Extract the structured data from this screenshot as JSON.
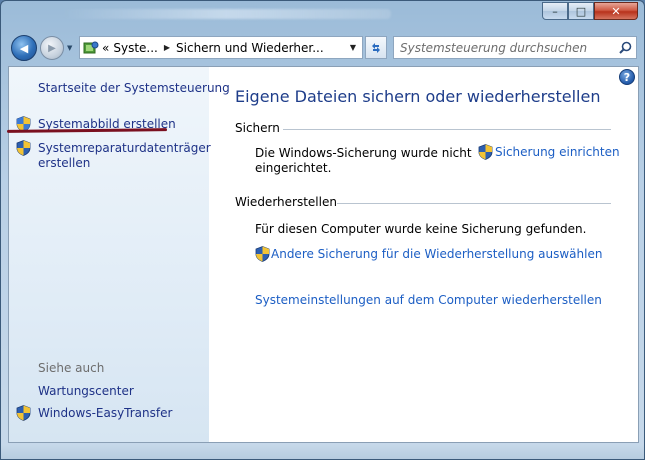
{
  "window": {
    "caption": {
      "minimize": "–",
      "maximize": "□",
      "close": "✕"
    }
  },
  "nav": {
    "back_glyph": "◀",
    "forward_glyph": "▶",
    "history_glyph": "▼",
    "address": {
      "overflow": "«",
      "crumb1": "Syste...",
      "crumb2": "Sichern und Wiederher...",
      "sep": "▶",
      "drop": "▼"
    },
    "search_placeholder": "Systemsteuerung durchsuchen"
  },
  "sidebar": {
    "home_link": "Startseite der Systemsteuerung",
    "task1": "Systemabbild erstellen",
    "task2_line1": "Systemreparaturdatenträger",
    "task2_line2": "erstellen",
    "see_also_label": "Siehe auch",
    "see_also1": "Wartungscenter",
    "see_also2": "Windows-EasyTransfer"
  },
  "main": {
    "help": "?",
    "title": "Eigene Dateien sichern oder wiederherstellen",
    "backup_heading": "Sichern",
    "backup_status_line1": "Die Windows-Sicherung wurde nicht",
    "backup_status_line2": "eingerichtet.",
    "setup_backup_link": "Sicherung einrichten",
    "restore_heading": "Wiederherstellen",
    "restore_status": "Für diesen Computer wurde keine Sicherung gefunden.",
    "other_backup_link": "Andere Sicherung für die Wiederherstellung auswählen",
    "system_restore_link": "Systemeinstellungen auf dem Computer wiederherstellen"
  },
  "colors": {
    "link": "#1c5ec4",
    "sidebar_link": "#1e3287",
    "title": "#1e3d8a",
    "annotation_underline": "#7a1020"
  }
}
